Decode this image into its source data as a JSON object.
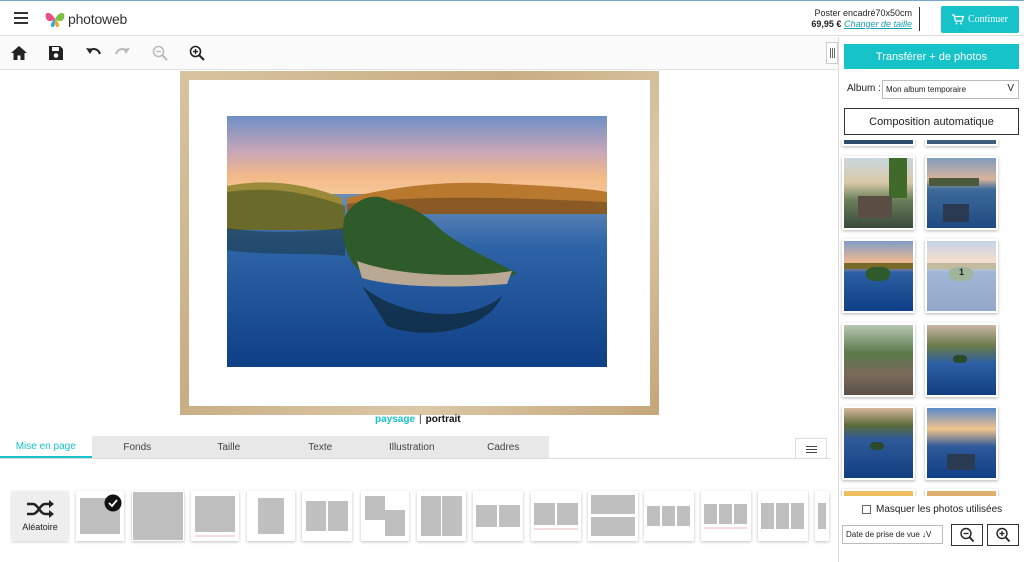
{
  "header": {
    "logo_text": "photoweb",
    "product_name": "Poster encadré70x50cm",
    "price": "69,95 €",
    "change_size_link": "Changer de taille",
    "continue_label": "Continuer"
  },
  "toolbar": {
    "icons": [
      "home-icon",
      "save-icon",
      "undo-icon",
      "redo-icon",
      "zoom-out-icon",
      "zoom-in-icon"
    ]
  },
  "orientation": {
    "landscape": "paysage",
    "separator": "|",
    "portrait": "portrait"
  },
  "tabs": [
    "Mise en page",
    "Fonds",
    "Taille",
    "Texte",
    "Illustration",
    "Cadres"
  ],
  "active_tab": "Mise en page",
  "layouts": {
    "random_label": "Aléatoire"
  },
  "sidebar": {
    "transfer_label": "Transférer + de photos",
    "album_label": "Album :",
    "album_value": "Mon album temporaire",
    "auto_compose_label": "Composition automatique",
    "used_badge": "1",
    "hide_used_label": "Masquer les photos utilisées",
    "sort_value": "Date de prise de vue ↓",
    "sort_chevron": "V"
  },
  "colors": {
    "accent": "#16c3c9"
  }
}
